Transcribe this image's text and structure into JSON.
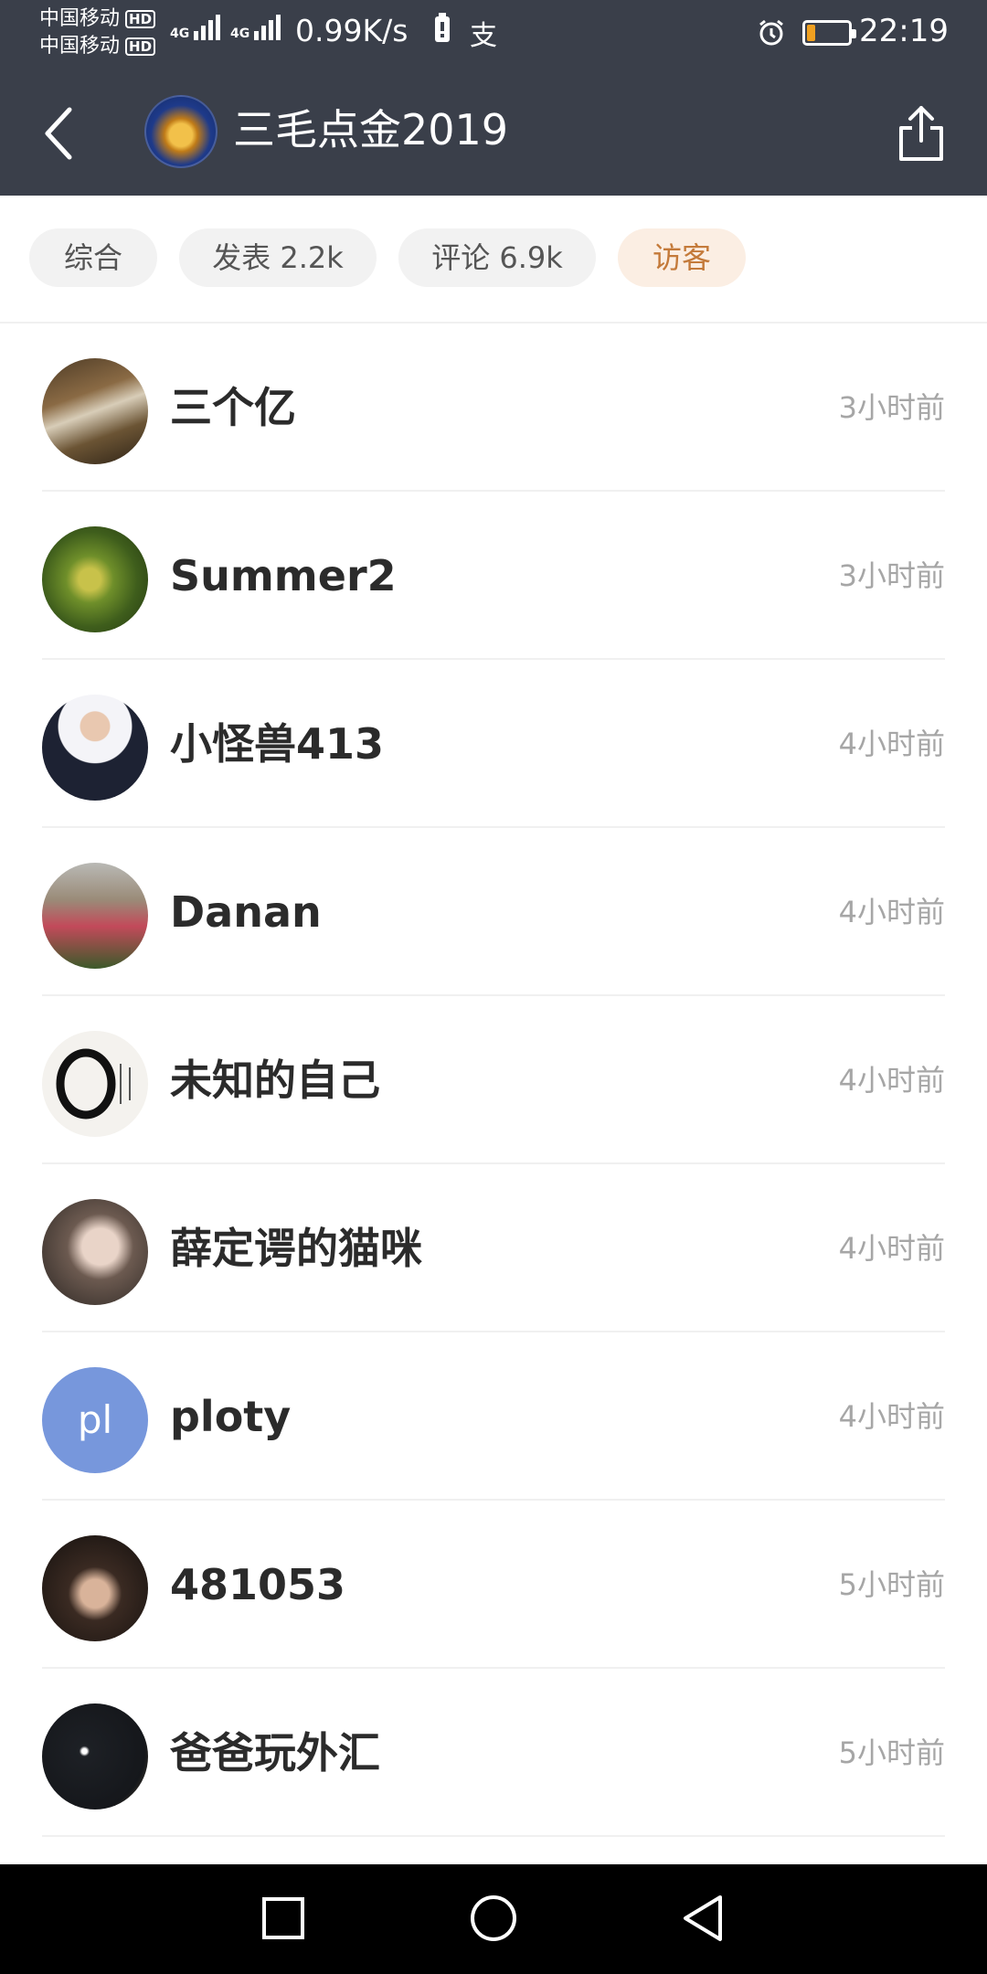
{
  "status_bar": {
    "carrier_1": "中国移动",
    "carrier_2": "中国移动",
    "hd_label": "HD",
    "network_1": "4G",
    "network_2": "4G",
    "speed": "0.99K/s",
    "alipay_icon": "支",
    "time": "22:19",
    "battery_level": 0.2
  },
  "header": {
    "title": "三毛点金2019",
    "back_icon": "chevron-left-icon",
    "share_icon": "share-icon"
  },
  "tabs": [
    {
      "label": "综合",
      "active": false
    },
    {
      "label": "发表 2.2k",
      "active": false
    },
    {
      "label": "评论 6.9k",
      "active": false
    },
    {
      "label": "访客",
      "active": true
    }
  ],
  "visitors": [
    {
      "name": "三个亿",
      "time": "3小时前",
      "avatar": "photo-sign"
    },
    {
      "name": "Summer2",
      "time": "3小时前",
      "avatar": "photo-plant"
    },
    {
      "name": "小怪兽413",
      "time": "4小时前",
      "avatar": "photo-man"
    },
    {
      "name": "Danan",
      "time": "4小时前",
      "avatar": "photo-garden"
    },
    {
      "name": "未知的自己",
      "time": "4小时前",
      "avatar": "photo-ink-circle"
    },
    {
      "name": "薛定谔的猫咪",
      "time": "4小时前",
      "avatar": "photo-girl"
    },
    {
      "name": "ploty",
      "time": "4小时前",
      "avatar_letter": "pl"
    },
    {
      "name": "481053",
      "time": "5小时前",
      "avatar": "photo-kid"
    },
    {
      "name": "爸爸玩外汇",
      "time": "5小时前",
      "avatar": "photo-night"
    }
  ],
  "system_nav": [
    "square-icon",
    "circle-icon",
    "triangle-back-icon"
  ],
  "colors": {
    "header_bg": "#3a3f4a",
    "active_tab_text": "#c47a3a",
    "active_tab_bg": "#fbeee3",
    "letter_avatar_bg": "#7797dc"
  }
}
